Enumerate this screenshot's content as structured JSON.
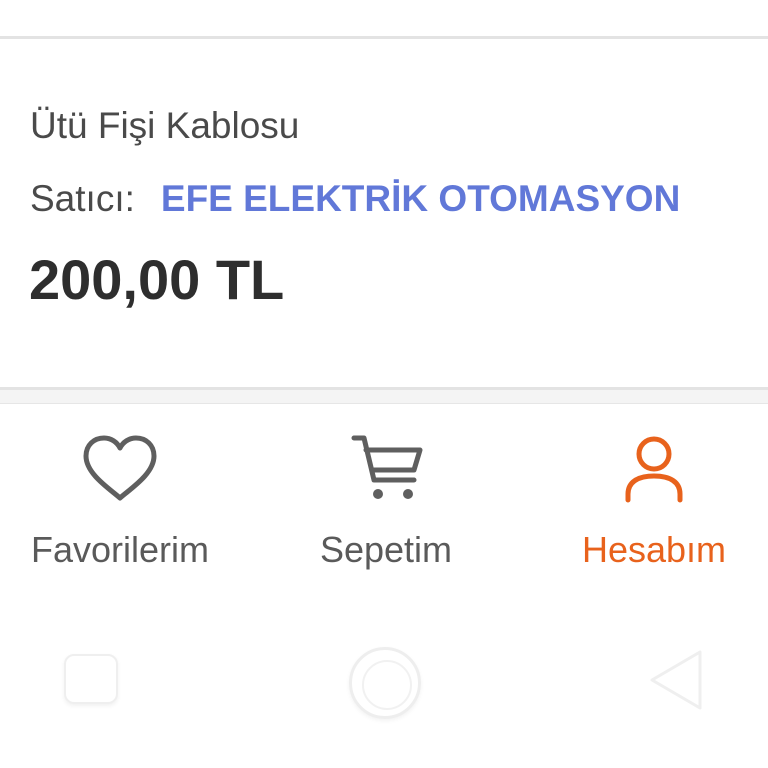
{
  "product": {
    "title": "Ütü Fişi Kablosu",
    "seller_label": "Satıcı:",
    "seller_name": "EFE ELEKTRİK OTOMASYON",
    "price": "200,00 TL"
  },
  "tab_bar": {
    "items": [
      {
        "label": "Favorilerim",
        "icon": "heart-icon",
        "active": false
      },
      {
        "label": "Sepetim",
        "icon": "cart-icon",
        "active": false
      },
      {
        "label": "Hesabım",
        "icon": "user-icon",
        "active": true
      }
    ]
  },
  "system_nav": {
    "buttons": [
      "recents-icon",
      "home-icon",
      "back-icon"
    ]
  },
  "colors": {
    "seller_link": "#6178d8",
    "active_tab": "#e8621c",
    "inactive_tab": "#5a5a5a",
    "price_text": "#2e2e2e"
  }
}
